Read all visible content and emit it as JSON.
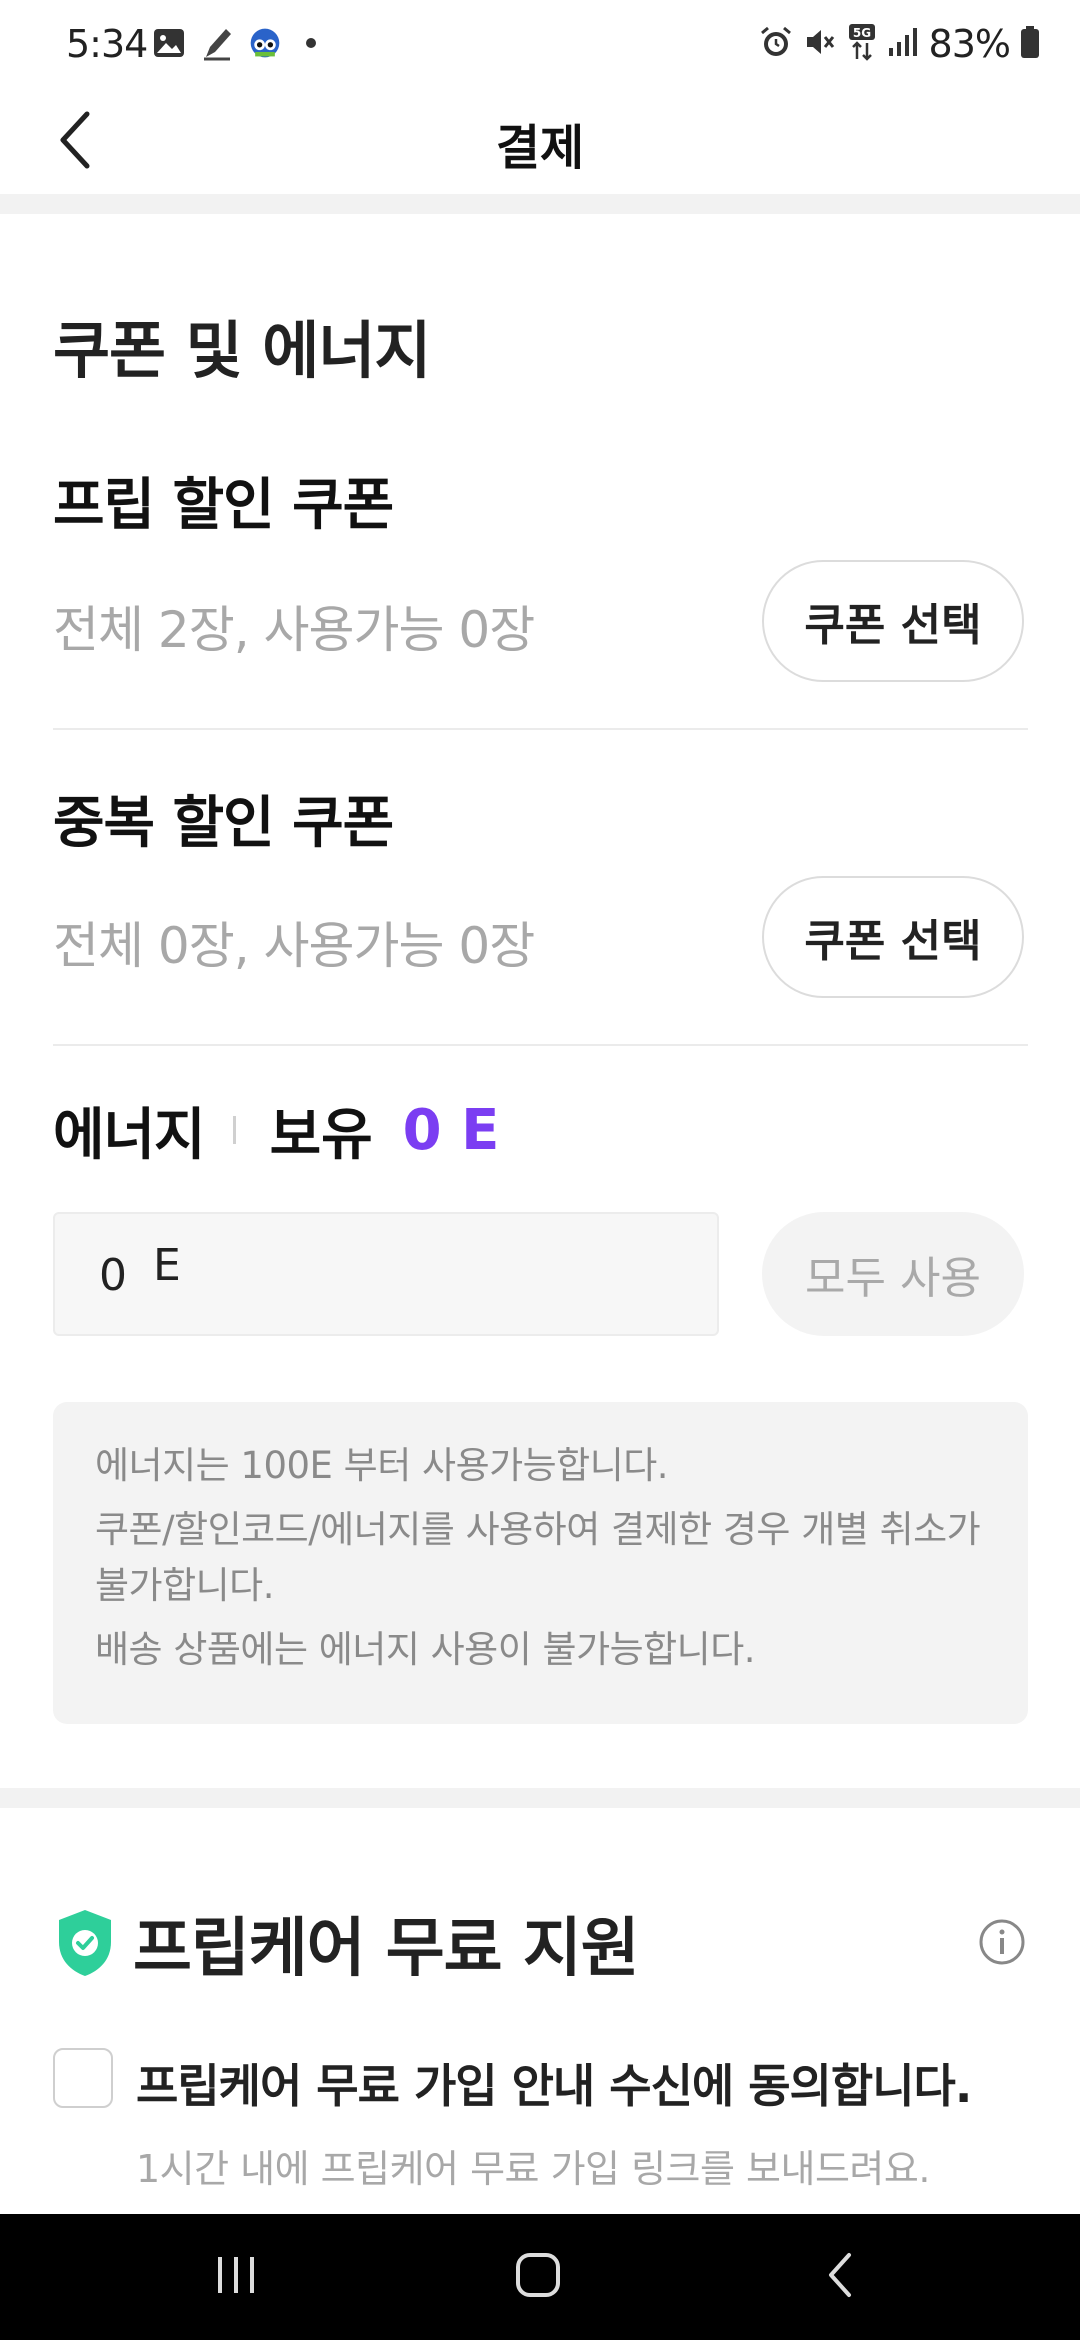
{
  "status_bar": {
    "time": "5:34",
    "battery": "83%",
    "network": "5G",
    "icons": [
      "image-icon",
      "pen-icon",
      "avatar-icon",
      "dot-icon",
      "alarm-icon",
      "mute-icon",
      "5g-icon",
      "signal-icon",
      "battery-icon"
    ]
  },
  "app_bar": {
    "title": "결제",
    "back_icon": "chevron-left-icon"
  },
  "coupons_energy": {
    "section_title": "쿠폰 및 에너지",
    "frip_coupon": {
      "title": "프립 할인 쿠폰",
      "summary": "전체 2장, 사용가능 0장",
      "button": "쿠폰 선택"
    },
    "dup_coupon": {
      "title": "중복 할인 쿠폰",
      "summary": "전체 0장, 사용가능 0장",
      "button": "쿠폰 선택"
    },
    "energy": {
      "label": "에너지",
      "owned_label": "보유",
      "owned_value": "0 E",
      "input_value": "0",
      "input_unit": "E",
      "use_all_button": "모두 사용",
      "accent_color": "#7b3ef2"
    },
    "notices": [
      "에너지는 100E 부터 사용가능합니다.",
      "쿠폰/할인코드/에너지를 사용하여 결제한 경우 개별 취소가 불가합니다.",
      "배송 상품에는 에너지 사용이 불가능합니다."
    ]
  },
  "fripcare": {
    "title": "프립케어 무료 지원",
    "shield_icon": "shield-check-icon",
    "info_icon": "info-icon",
    "agree_text": "프립케어 무료 가입 안내 수신에 동의합니다.",
    "agree_subtext": "1시간 내에 프립케어 무료 가입 링크를 보내드려요.",
    "checked": false,
    "shield_color": "#2ecf9a"
  },
  "nav_bar": {
    "buttons": [
      "recent-apps-icon",
      "home-icon",
      "back-icon"
    ]
  }
}
